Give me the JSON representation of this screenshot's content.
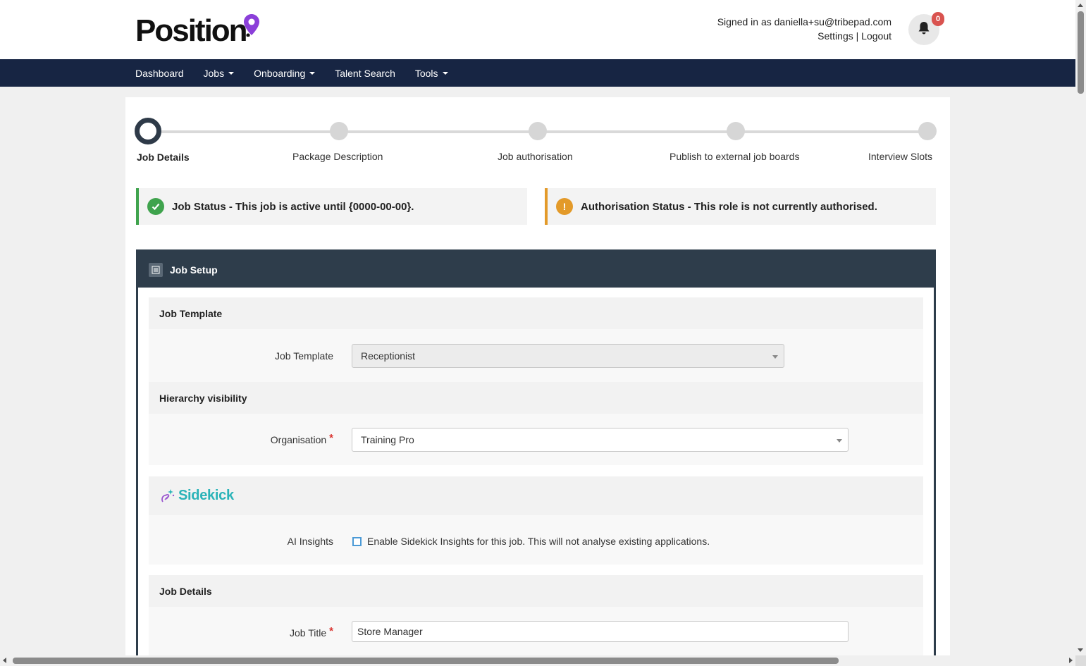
{
  "header": {
    "logo_text": "Position",
    "signed_in_text": "Signed in as daniella+su@tribepad.com",
    "settings_link": "Settings",
    "separator": "|",
    "logout_link": "Logout",
    "notification_count": "0",
    "accent_color": "#8b3fd9"
  },
  "nav": {
    "items": [
      {
        "label": "Dashboard",
        "dropdown": false
      },
      {
        "label": "Jobs",
        "dropdown": true
      },
      {
        "label": "Onboarding",
        "dropdown": true
      },
      {
        "label": "Talent Search",
        "dropdown": false
      },
      {
        "label": "Tools",
        "dropdown": true
      }
    ],
    "background_color": "#172543"
  },
  "stepper": {
    "steps": [
      {
        "label": "Job Details",
        "active": true
      },
      {
        "label": "Package Description",
        "active": false
      },
      {
        "label": "Job authorisation",
        "active": false
      },
      {
        "label": "Publish to external job boards",
        "active": false
      },
      {
        "label": "Interview Slots",
        "active": false
      }
    ]
  },
  "status": {
    "job": {
      "text": "Job Status - This job is active until {0000-00-00}.",
      "icon": "check-circle-icon",
      "color": "#3fa34d"
    },
    "auth": {
      "text": "Authorisation Status - This role is not currently authorised.",
      "icon": "exclamation-circle-icon",
      "color": "#e39a29"
    }
  },
  "job_setup": {
    "title": "Job Setup",
    "sections": {
      "job_template": {
        "heading": "Job Template",
        "field_label": "Job Template",
        "value": "Receptionist"
      },
      "hierarchy": {
        "heading": "Hierarchy visibility",
        "field_label": "Organisation",
        "required": "*",
        "value": "Training Pro"
      },
      "sidekick": {
        "logo_text": "Sidekick",
        "field_label": "AI Insights",
        "checkbox_text": "Enable Sidekick Insights for this job. This will not analyse existing applications.",
        "checked": false
      },
      "job_details": {
        "heading": "Job Details",
        "field_label": "Job Title",
        "required": "*",
        "value": "Store Manager"
      }
    }
  }
}
